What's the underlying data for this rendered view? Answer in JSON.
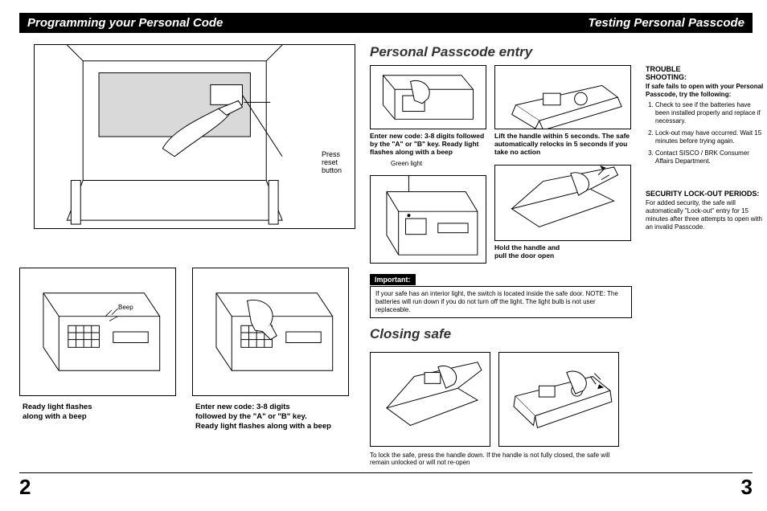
{
  "header": {
    "left": "Programming your Personal Code",
    "right": "Testing Personal Passcode"
  },
  "left": {
    "top_label": "Press\nreset\nbutton",
    "beep_label": "Beep",
    "bl_caption": "Ready light flashes\nalong with a beep",
    "br_caption": "Enter new code: 3-8 digits\nfollowed by the \"A\" or \"B\" key.\nReady light flashes along with a beep"
  },
  "right": {
    "section1_title": "Personal Passcode entry",
    "entry_caption1": "Enter new code: 3-8 digits followed by the \"A\" or \"B\" key. Ready light flashes along with a beep",
    "green_label": "Green light",
    "entry_caption2": "Lift the handle within 5 seconds. The safe automatically relocks in 5 seconds if you take no action",
    "entry_caption3": "Hold the handle and\npull the door open",
    "important_head": "Important:",
    "important_body": "If your safe has an interior light, the switch is located inside the safe door. NOTE: The batteries will run down if you do not turn off the light. The light bulb is not user replaceable.",
    "section2_title": "Closing safe",
    "closing_note": "To lock the safe, press the handle down. If the handle is not fully closed, the safe will remain unlocked or will not re-open",
    "trouble": {
      "head": "TROUBLE\nSHOOTING:",
      "sub": "If safe fails to open with your Personal Passcode, try the following:",
      "items": [
        "Check to see if the batteries have been installed properly and replace if necessary.",
        "Lock-out may have occurred. Wait 15 minutes before trying again.",
        "Contact SISCO / BRK Consumer Affairs Department."
      ]
    },
    "security": {
      "head": "SECURITY LOCK-OUT PERIODS:",
      "body": "For added security, the safe will automatically \"Lock-out\" entry for 15 minutes after three attempts to open with an invalid Passcode."
    }
  },
  "pages": {
    "left": "2",
    "right": "3"
  }
}
